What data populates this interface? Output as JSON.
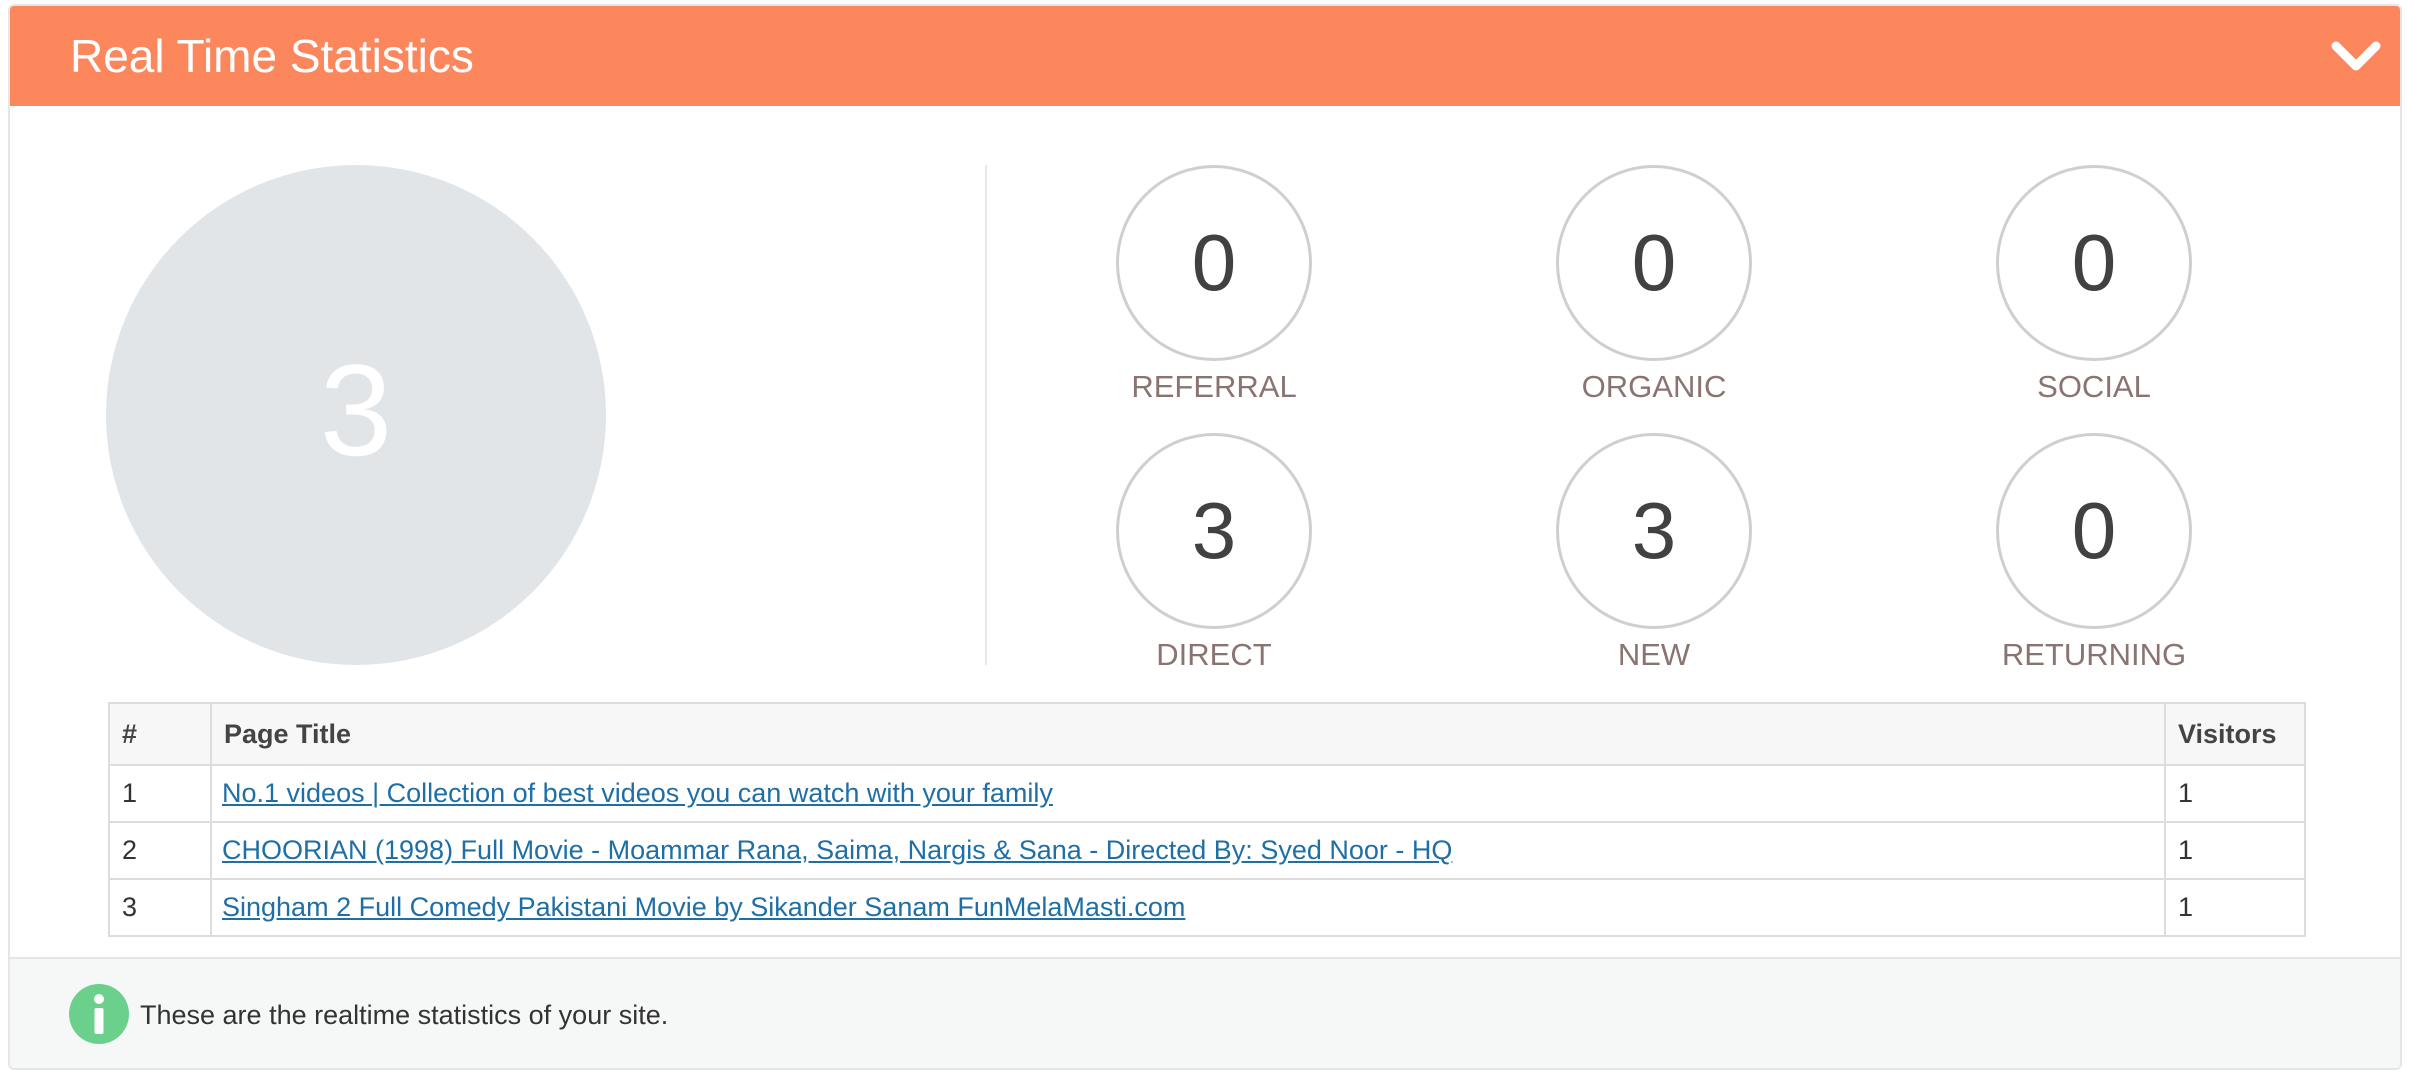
{
  "header": {
    "title": "Real Time Statistics",
    "toggle_icon": "chevron-down-icon",
    "color": "#fc875d"
  },
  "summary": {
    "total_visitors": "3"
  },
  "stats": [
    {
      "label": "REFERRAL",
      "value": "0"
    },
    {
      "label": "ORGANIC",
      "value": "0"
    },
    {
      "label": "SOCIAL",
      "value": "0"
    },
    {
      "label": "DIRECT",
      "value": "3"
    },
    {
      "label": "NEW",
      "value": "3"
    },
    {
      "label": "RETURNING",
      "value": "0"
    }
  ],
  "table": {
    "columns": [
      "#",
      "Page Title",
      "Visitors"
    ],
    "rows": [
      {
        "num": "1",
        "title": "No.1 videos | Collection of best videos you can watch with your family",
        "visitors": "1"
      },
      {
        "num": "2",
        "title": "CHOORIAN (1998) Full Movie - Moammar Rana, Saima, Nargis & Sana - Directed By: Syed Noor - HQ",
        "visitors": "1"
      },
      {
        "num": "3",
        "title": "Singham 2 Full Comedy Pakistani Movie by Sikander Sanam FunMelaMasti.com",
        "visitors": "1"
      }
    ]
  },
  "footer": {
    "icon": "info-icon",
    "icon_color": "#6bd08c",
    "text": "These are the realtime statistics of your site."
  }
}
